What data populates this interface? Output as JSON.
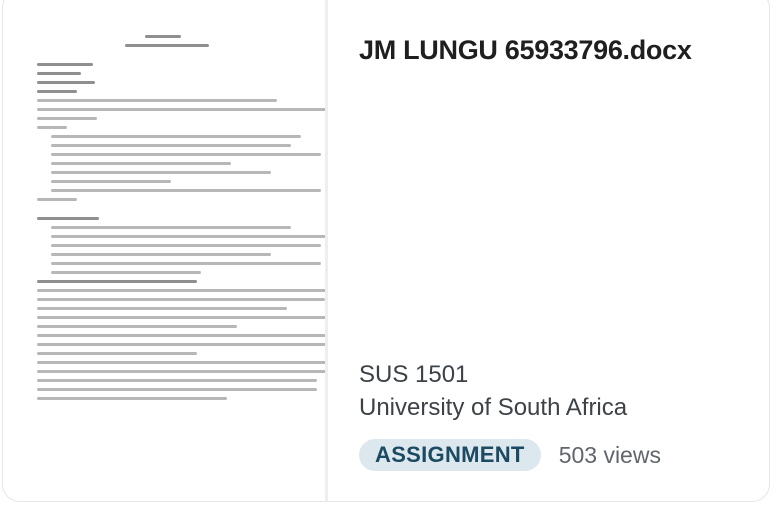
{
  "document": {
    "filename": "JM LUNGU 65933796.docx",
    "course": "SUS 1501",
    "institution": "University of South Africa",
    "type_badge": "ASSIGNMENT",
    "views": "503 views"
  },
  "colors": {
    "badge_bg": "#dde8ee",
    "badge_text": "#1c4a62"
  }
}
